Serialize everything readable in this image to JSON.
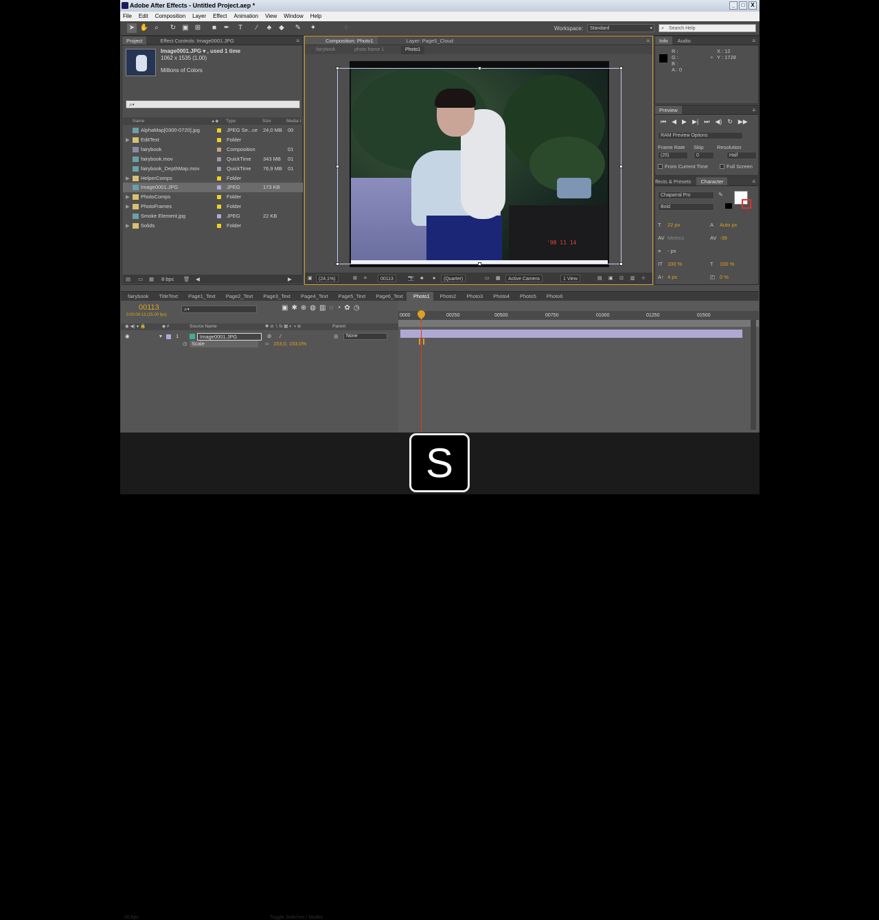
{
  "window": {
    "title": "Adobe After Effects - Untitled Project.aep *",
    "buttons": [
      "_",
      "□",
      "X"
    ]
  },
  "menu": [
    "File",
    "Edit",
    "Composition",
    "Layer",
    "Effect",
    "Animation",
    "View",
    "Window",
    "Help"
  ],
  "toolbar": {
    "workspace_label": "Workspace:",
    "workspace_value": "Standard",
    "search_placeholder": "Search Help"
  },
  "project": {
    "tabs": [
      "Project",
      "Effect Controls: Image0001.JPG"
    ],
    "item_name": "Image0001.JPG ▾ , used 1 time",
    "item_dims": "1062 x 1535 (1,00)",
    "item_colors": "Millions of Colors",
    "search": "",
    "columns": {
      "name": "Name",
      "type": "Type",
      "size": "Size",
      "media": "Media I"
    },
    "rows": [
      {
        "name": "AlphaMap[0300-0720].jpg",
        "type": "JPEG Se...ce",
        "size": "24,0 MB",
        "media": "00",
        "color": "#f0d020"
      },
      {
        "name": "EditText",
        "type": "Folder",
        "size": "",
        "media": "",
        "color": "#f0d020"
      },
      {
        "name": "fairybook",
        "type": "Composition",
        "size": "",
        "media": "01",
        "color": "#c8a878"
      },
      {
        "name": "fairybook.mov",
        "type": "QuickTime",
        "size": "343 MB",
        "media": "01",
        "color": "#9a9aa8"
      },
      {
        "name": "fairybook_DepthMap.mov",
        "type": "QuickTime",
        "size": "76,9 MB",
        "media": "01",
        "color": "#9a9aa8"
      },
      {
        "name": "HelperComps",
        "type": "Folder",
        "size": "",
        "media": "",
        "color": "#f0d020"
      },
      {
        "name": "Image0001.JPG",
        "type": "JPEG",
        "size": "173 KB",
        "media": "",
        "color": "#b0a8d8"
      },
      {
        "name": "PhotoComps",
        "type": "Folder",
        "size": "",
        "media": "",
        "color": "#f0d020"
      },
      {
        "name": "PhotoFrames",
        "type": "Folder",
        "size": "",
        "media": "",
        "color": "#f0d020"
      },
      {
        "name": "Smoke Element.jpg",
        "type": "JPEG",
        "size": "22 KB",
        "media": "",
        "color": "#b0a8d8"
      },
      {
        "name": "Solids",
        "type": "Folder",
        "size": "",
        "media": "",
        "color": "#f0d020"
      }
    ],
    "footer_bpc": "8 bpc"
  },
  "composition": {
    "tabs": [
      "Composition: Photo1",
      "Layer: Page5_Cloud"
    ],
    "breadcrumbs": [
      "fairybook",
      "photo frame 1",
      "Photo1"
    ],
    "photo_date": "'98 11 14",
    "footer": {
      "zoom": "(24,1%)",
      "timecode": "00113",
      "resolution": "(Quarter)",
      "camera": "Active Camera",
      "views": "1 View"
    }
  },
  "info": {
    "tabs": [
      "Info",
      "Audio"
    ],
    "r": "R :",
    "g": "G :",
    "b": "B :",
    "a": "A : 0",
    "x": "X : 12",
    "y": "Y : 1728"
  },
  "preview": {
    "title": "Preview",
    "ram_options": "RAM Preview Options",
    "frame_rate_label": "Frame Rate",
    "skip_label": "Skip",
    "resolution_label": "Resolution",
    "frame_rate": "(25)",
    "skip": "0",
    "resolution": "Half",
    "from_current": "From Current Time",
    "full_screen": "Full Screen"
  },
  "character": {
    "tabs": [
      "ffects & Presets",
      "Character"
    ],
    "font": "Chaparral Pro",
    "style": "Bold",
    "size": "22 px",
    "leading": "Auto px",
    "kerning": "Metrics",
    "tracking": "-39",
    "stroke": "- px",
    "vscale": "100 %",
    "hscale": "100 %",
    "baseline": "4 px",
    "tsume": "0 %"
  },
  "timeline": {
    "tabs": [
      "fairybook",
      "TitleText",
      "Page1_Text",
      "Page2_Text",
      "Page3_Text",
      "Page4_Text",
      "Page5_Text",
      "Page6_Text",
      "Photo1",
      "Photo2",
      "Photo3",
      "Photo4",
      "Photo5",
      "Photo6"
    ],
    "active_tab": "Photo1",
    "timecode": "00113",
    "timecode_sub": "0:00:04:13 (25.00 fps)",
    "source_name_label": "Source Name",
    "parent_label": "Parent",
    "layer_num": "1",
    "layer_name": "Image0001.JPG",
    "parent_value": "None",
    "property_name": "Scale",
    "property_value": "153,0, 153,0%",
    "ruler": [
      "0000",
      "00250",
      "00500",
      "00750",
      "01000",
      "01250",
      "01500"
    ]
  },
  "watermark": {
    "logo": "S",
    "footer_left": "00 bpc",
    "footer_mid": "Toggle Switches / Modes"
  }
}
